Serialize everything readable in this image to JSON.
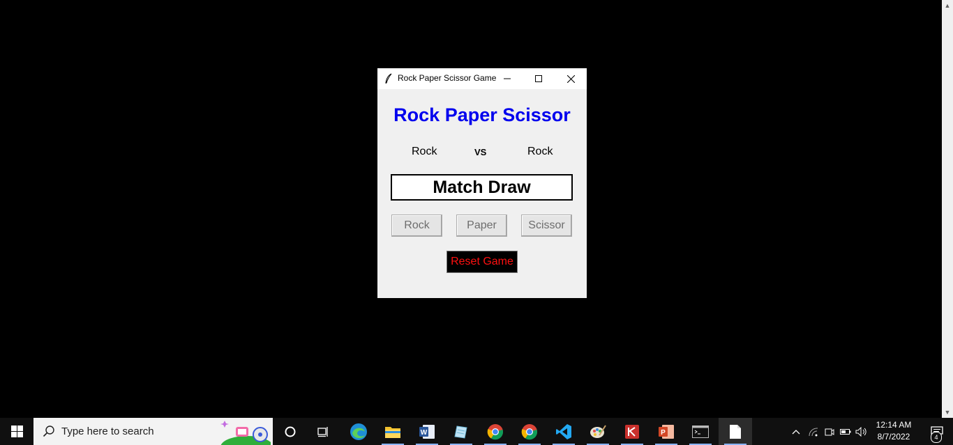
{
  "window": {
    "title": "Rock Paper Scissor Game",
    "heading": "Rock Paper Scissor",
    "player_choice": "Rock",
    "vs_label": "VS",
    "computer_choice": "Rock",
    "result": "Match Draw",
    "buttons": {
      "rock": "Rock",
      "paper": "Paper",
      "scissor": "Scissor",
      "reset": "Reset Game"
    },
    "colors": {
      "heading": "#0000ee",
      "reset_text": "#ff1010",
      "reset_bg": "#000000"
    }
  },
  "taskbar": {
    "search_placeholder": "Type here to search",
    "apps": [
      "cortana-icon",
      "task-view-icon",
      "edge-icon",
      "file-explorer-icon",
      "word-icon",
      "notepad-icon",
      "chrome-icon",
      "chrome-icon",
      "vscode-icon",
      "paint-icon",
      "kingsoft-icon",
      "powerpoint-icon",
      "terminal-icon",
      "file-icon"
    ],
    "time": "12:14 AM",
    "date": "8/7/2022",
    "notification_count": "4"
  }
}
